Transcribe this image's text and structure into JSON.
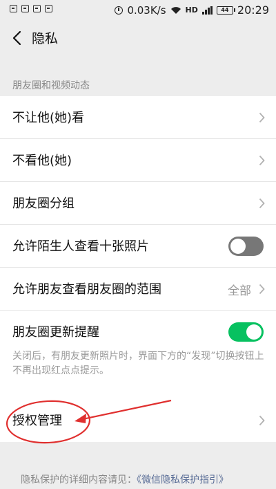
{
  "status_bar": {
    "network_speed": "0.03K/s",
    "hd": "HD",
    "battery": "44",
    "time": "20:29"
  },
  "header": {
    "title": "隐私"
  },
  "section": {
    "label": "朋友圈和视频动态"
  },
  "items": [
    {
      "label": "不让他(她)看"
    },
    {
      "label": "不看他(她)"
    },
    {
      "label": "朋友圈分组"
    },
    {
      "label": "允许陌生人查看十张照片",
      "toggle": "off"
    },
    {
      "label": "允许朋友查看朋友圈的范围",
      "value": "全部"
    },
    {
      "label": "朋友圈更新提醒",
      "toggle": "on"
    }
  ],
  "hint": "关闭后，有朋友更新照片时，界面下方的“发现”切换按钮上不再出现红点点提示。",
  "auth": {
    "label": "授权管理"
  },
  "footer": {
    "prefix": "隐私保护的详细内容请见：",
    "link": "《微信隐私保护指引》"
  },
  "colors": {
    "accent_green": "#07c160",
    "toggle_off": "#777777",
    "annotation_red": "#e0302f",
    "link": "#576b95"
  }
}
